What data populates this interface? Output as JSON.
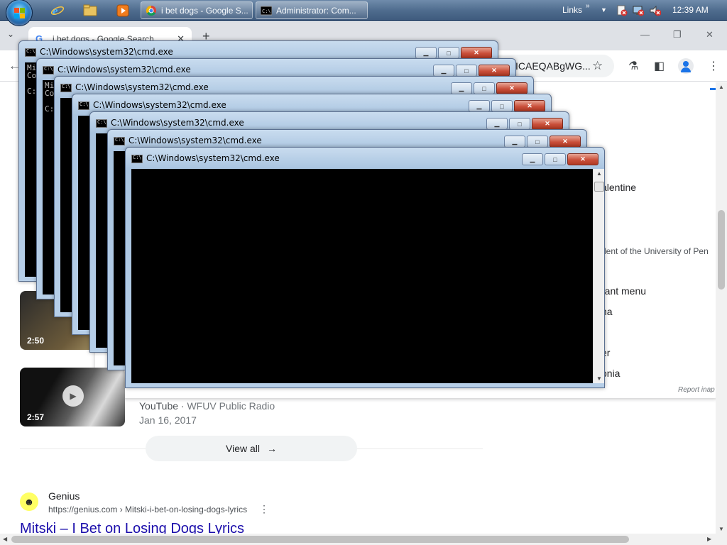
{
  "taskbar": {
    "tasks": [
      "i bet dogs - Google S...",
      "Administrator:  Com..."
    ],
    "links_label": "Links",
    "links_chevron": "»",
    "clock": "12:39 AM"
  },
  "browser": {
    "tablist_icon": "⌄",
    "tab_title": "i bet dogs - Google Search",
    "tab_close": "✕",
    "new_tab": "+",
    "minimize": "—",
    "restore": "❐",
    "close": "✕",
    "back_icon": "←",
    "omnibox_text": "ICAEQABgWG...",
    "star_icon": "☆",
    "labs_icon": "⚗",
    "sidepanel_icon": "◧",
    "menu_icon": "⋮"
  },
  "knowledge_panel": {
    "items": [
      "alentine",
      "dent of the University of Pen",
      "rant menu",
      "na",
      "er",
      "onia"
    ],
    "report": "Report inap"
  },
  "videos": [
    {
      "duration": "2:50"
    },
    {
      "duration": "2:57",
      "play_icon": "▶",
      "source": "YouTube",
      "publisher": "WFUV Public Radio",
      "date": "Jan 16, 2017"
    }
  ],
  "view_all": {
    "label": "View all",
    "icon": "→"
  },
  "result": {
    "site_icon": "☻",
    "site_name": "Genius",
    "url": "https://genius.com › Mitski-i-bet-on-losing-dogs-lyrics",
    "more_icon": "⋮",
    "title": "Mitski – I Bet on Losing Dogs Lyrics"
  },
  "cmd_windows": [
    {
      "title": "C:\\Windows\\system32\\cmd.exe",
      "lines": "Mi\nCo\n\nC:"
    },
    {
      "title": "C:\\Windows\\system32\\cmd.exe",
      "lines": "Mi\nCo\n\nC:"
    },
    {
      "title": "C:\\Windows\\system32\\cmd.exe",
      "lines": ""
    },
    {
      "title": "C:\\Windows\\system32\\cmd.exe",
      "lines": ""
    },
    {
      "title": "C:\\Windows\\system32\\cmd.exe",
      "lines": ""
    },
    {
      "title": "C:\\Windows\\system32\\cmd.exe",
      "lines": ""
    },
    {
      "title": "C:\\Windows\\system32\\cmd.exe",
      "lines": ""
    }
  ],
  "cmd_buttons": {
    "minimize": "▁",
    "maximize": "□",
    "close": "✕"
  },
  "scroll_arrows": {
    "up": "▲",
    "down": "▼",
    "left": "◀",
    "right": "▶"
  }
}
